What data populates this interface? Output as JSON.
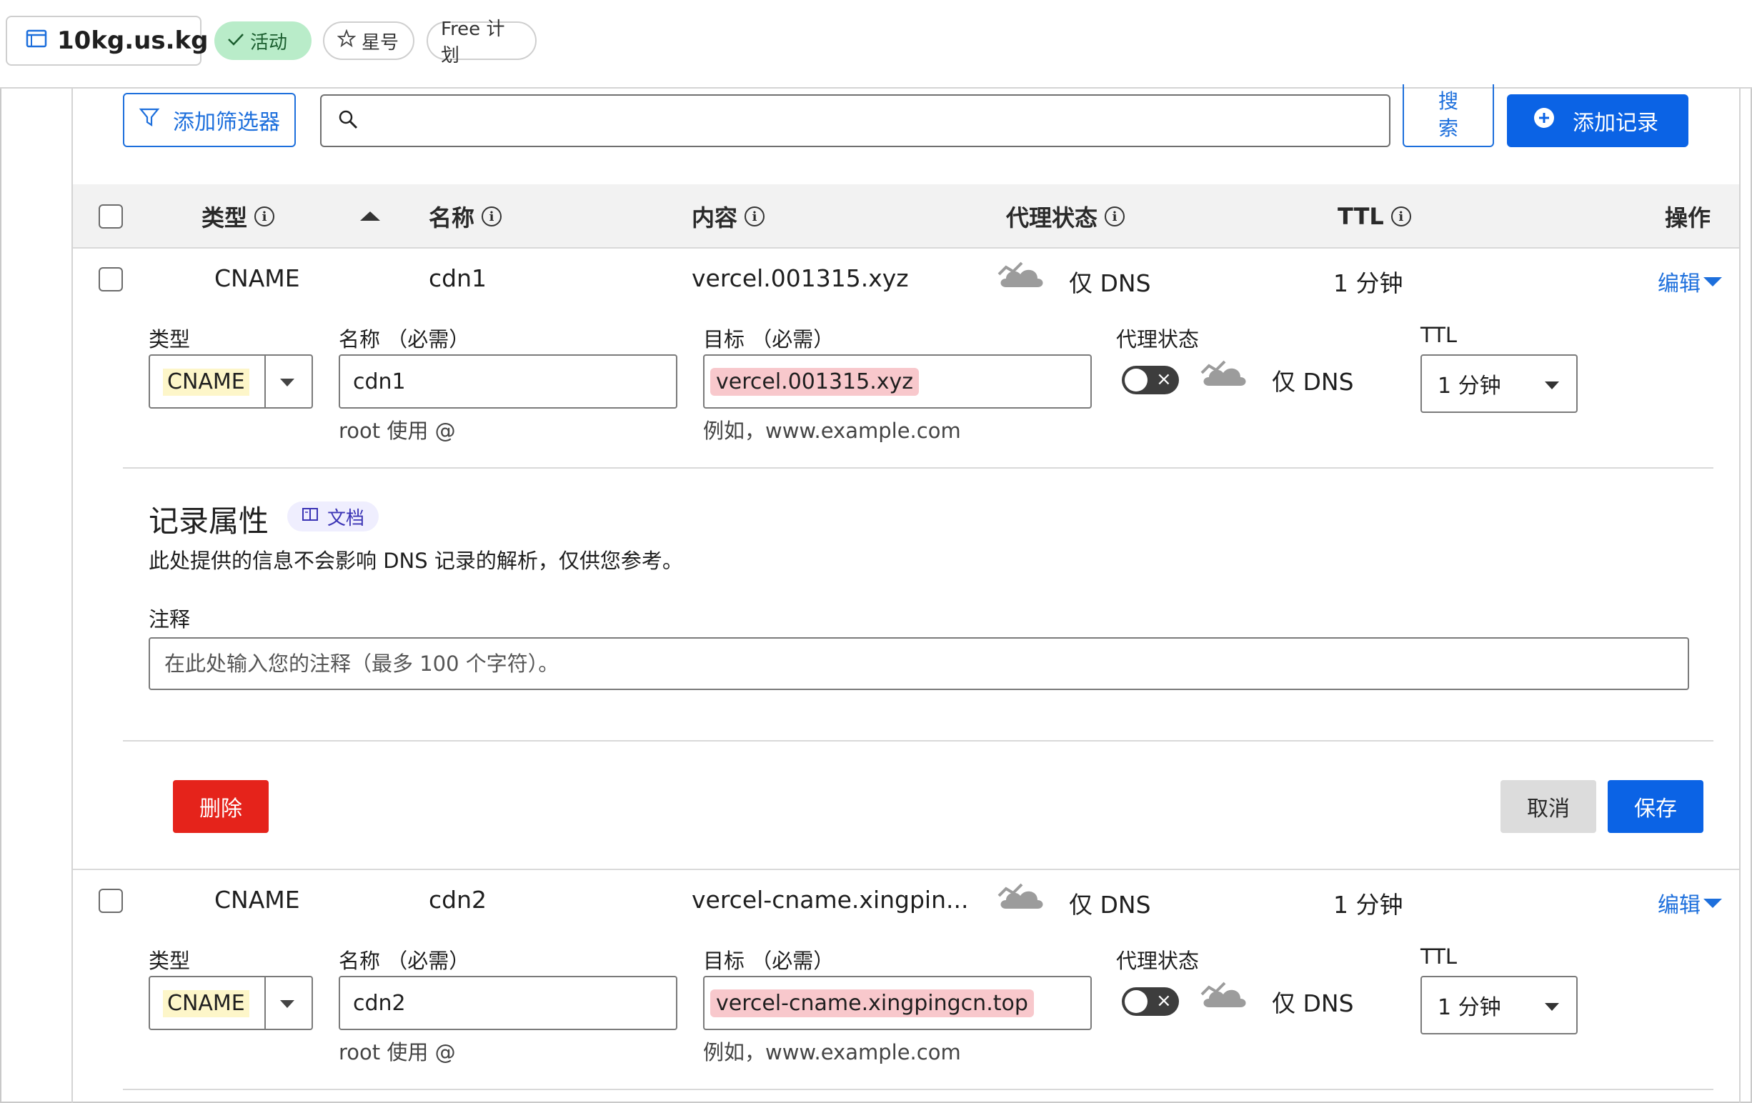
{
  "header": {
    "domain": "10kg.us.kg",
    "status_badge": "活动",
    "star_label": "星号",
    "plan_label": "Free 计划"
  },
  "toolbar": {
    "add_filter": "添加筛选器",
    "search_button": "搜索",
    "add_record": "添加记录"
  },
  "table": {
    "columns": {
      "type": "类型",
      "name": "名称",
      "content": "内容",
      "proxy": "代理状态",
      "ttl": "TTL",
      "actions": "操作"
    }
  },
  "records": [
    {
      "type": "CNAME",
      "name": "cdn1",
      "content": "vercel.001315.xyz",
      "proxy": "仅 DNS",
      "ttl": "1 分钟",
      "edit": "编辑",
      "form": {
        "type_label": "类型",
        "type_value": "CNAME",
        "name_label": "名称 （必需）",
        "name_value": "cdn1",
        "name_help": "root 使用 @",
        "target_label": "目标 （必需）",
        "target_value": "vercel.001315.xyz",
        "target_help": "例如，www.example.com",
        "proxy_label": "代理状态",
        "proxy_value": "仅 DNS",
        "ttl_label": "TTL",
        "ttl_value": "1 分钟"
      },
      "attributes": {
        "title": "记录属性",
        "doc_badge": "文档",
        "description": "此处提供的信息不会影响 DNS 记录的解析，仅供您参考。",
        "comment_label": "注释",
        "comment_placeholder": "在此处输入您的注释（最多 100 个字符）。"
      },
      "actions": {
        "delete": "删除",
        "cancel": "取消",
        "save": "保存"
      }
    },
    {
      "type": "CNAME",
      "name": "cdn2",
      "content": "vercel-cname.xingpin...",
      "proxy": "仅 DNS",
      "ttl": "1 分钟",
      "edit": "编辑",
      "form": {
        "type_label": "类型",
        "type_value": "CNAME",
        "name_label": "名称 （必需）",
        "name_value": "cdn2",
        "name_help": "root 使用 @",
        "target_label": "目标 （必需）",
        "target_value": "vercel-cname.xingpingcn.top",
        "target_help": "例如，www.example.com",
        "proxy_label": "代理状态",
        "proxy_value": "仅 DNS",
        "ttl_label": "TTL",
        "ttl_value": "1 分钟"
      }
    }
  ],
  "colors": {
    "accent": "#0b63e5",
    "danger": "#e5231b",
    "active_badge_bg": "#b9ecc9",
    "highlight_type": "#fdf6c9",
    "highlight_target": "#f8c8cc"
  },
  "icons": [
    "window-icon",
    "check-icon",
    "star-icon",
    "filter-icon",
    "search-icon",
    "plus-circle-icon",
    "info-icon",
    "sort-up-icon",
    "cloud-dns-icon",
    "book-icon",
    "chevron-down-icon"
  ]
}
